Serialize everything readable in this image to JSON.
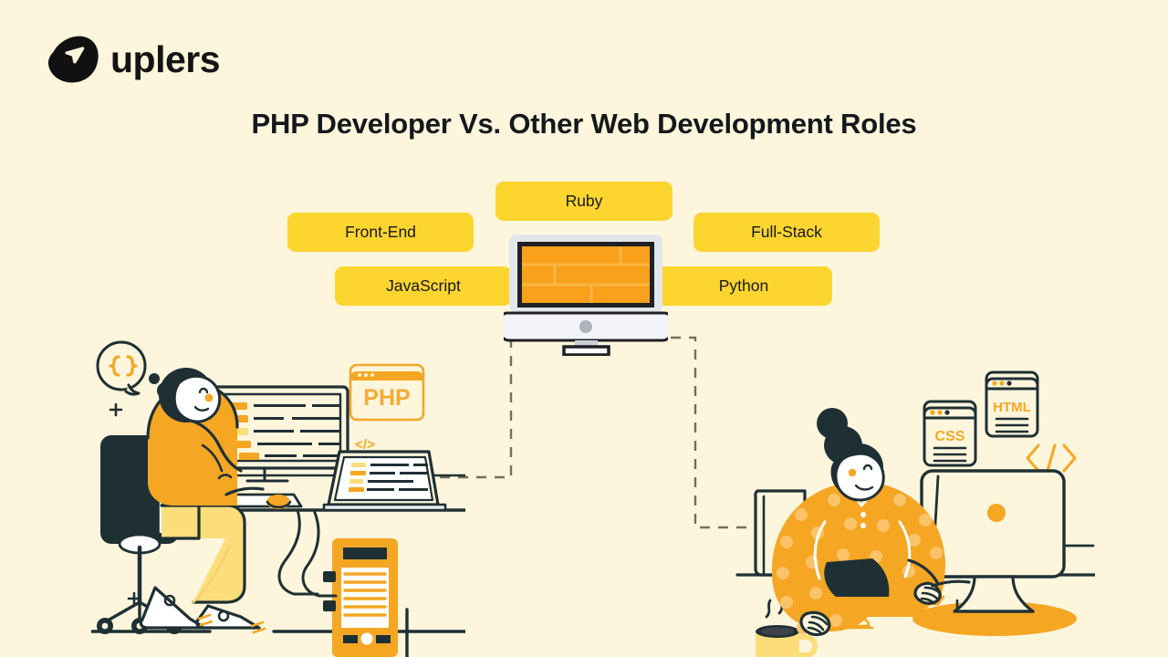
{
  "page": {
    "background_color": "#FDF6DC",
    "accent_yellow": "#FCD52F",
    "accent_orange": "#F5A623",
    "accent_orange_dark": "#F79D1E",
    "ink_navy": "#1F3035",
    "ink_black": "#141414"
  },
  "brand": {
    "name": "uplers",
    "logo_icon": "uplers-mark-icon"
  },
  "header": {
    "title": "PHP Developer Vs. Other Web Development Roles"
  },
  "role_pills": [
    {
      "id": "ruby",
      "label": "Ruby"
    },
    {
      "id": "front_end",
      "label": "Front-End"
    },
    {
      "id": "full_stack",
      "label": "Full-Stack"
    },
    {
      "id": "javascript",
      "label": "JavaScript"
    },
    {
      "id": "python",
      "label": "Python"
    }
  ],
  "center_scene": {
    "icon": "desktop-monitor-icon",
    "screen_pattern": "brick-wall"
  },
  "left_scene": {
    "icon": "php-developer-at-desk-illustration",
    "thought_bubble_symbol": "{}",
    "browser_card_label": "PHP",
    "laptop_symbol": "</>",
    "items": [
      "office-chair",
      "desktop-monitor-with-code",
      "laptop-with-code",
      "pc-tower",
      "keyboard",
      "mouse",
      "thought-bubble",
      "developer-person"
    ]
  },
  "right_scene": {
    "icon": "web-developer-at-desk-illustration",
    "cards": [
      {
        "id": "css",
        "label": "CSS"
      },
      {
        "id": "html",
        "label": "HTML"
      }
    ],
    "code_symbol": "< / >",
    "items": [
      "monitor-rear",
      "keyboard",
      "mouse",
      "coffee-cup",
      "developer-person"
    ]
  },
  "connectors": {
    "left_branch": "dashed-elbow-left",
    "right_branch": "dashed-elbow-right"
  }
}
